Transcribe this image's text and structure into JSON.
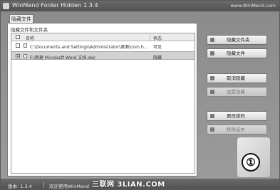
{
  "window": {
    "title": "WinMend Folder Hidden 1.3.4",
    "title_link": "www.WinMend.com"
  },
  "tab": {
    "label": "隐藏文件"
  },
  "panel": {
    "section_label": "隐藏文件和文件夹"
  },
  "list": {
    "columns": [
      "名称",
      "状态"
    ],
    "rows": [
      {
        "path": "C:\\Documents and Settings\\Administrator\\桌面\\com.b...",
        "status": "可见",
        "checked": false,
        "selected": false
      },
      {
        "path": "F:\\新建 Microsoft Word 文档.doc",
        "status": "隐藏",
        "checked": true,
        "selected": true
      }
    ]
  },
  "buttons": [
    {
      "label": "隐藏文件夹",
      "icon": "folder-icon",
      "enabled": true
    },
    {
      "label": "隐藏文件",
      "icon": "file-icon",
      "enabled": true
    },
    {
      "label": "取消隐藏",
      "icon": "unhide-icon",
      "enabled": true
    },
    {
      "label": "设置隐藏",
      "icon": "hide-icon",
      "enabled": false
    },
    {
      "label": "更改密码",
      "icon": "key-icon",
      "enabled": true
    },
    {
      "label": "移除选中",
      "icon": "remove-icon",
      "enabled": false
    }
  ],
  "step_badge": "①",
  "statusbar": {
    "version": "版本: 1.3.4",
    "welcome": "欢迎使用WinMend"
  },
  "watermark": "三联网 3LIAN.COM"
}
